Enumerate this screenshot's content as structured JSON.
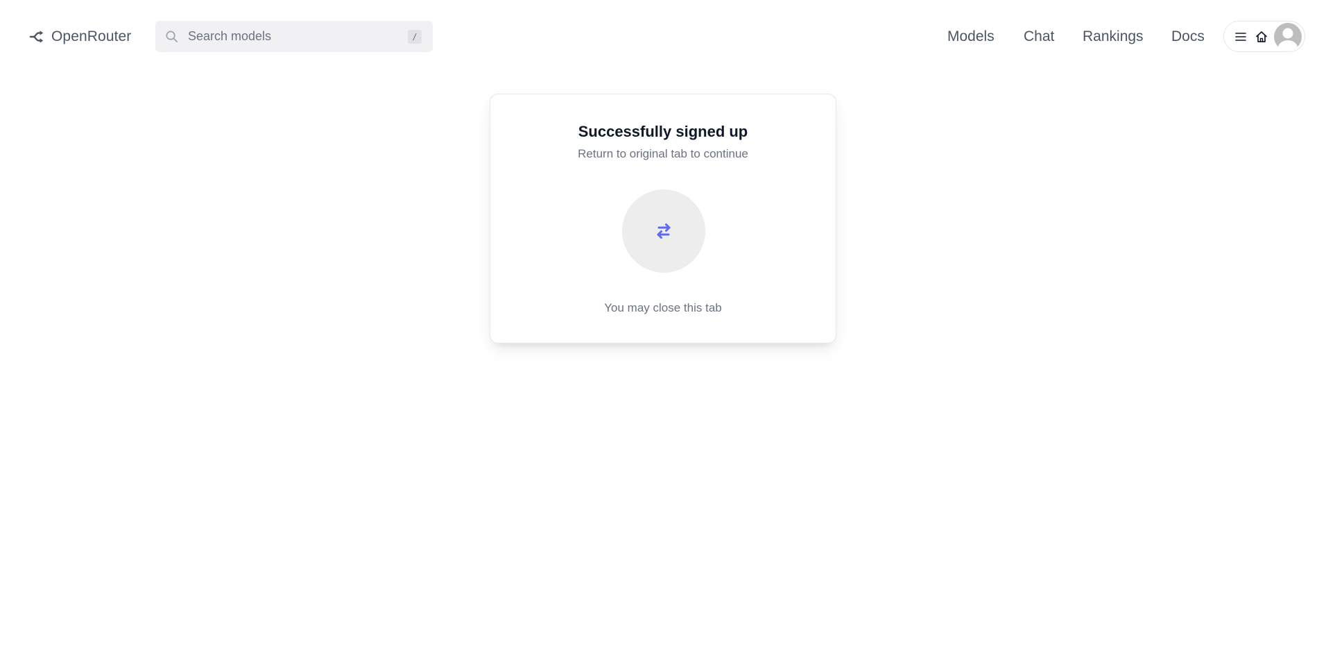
{
  "header": {
    "brand_name": "OpenRouter",
    "search": {
      "placeholder": "Search models",
      "shortcut_key": "/"
    },
    "nav": {
      "models": "Models",
      "chat": "Chat",
      "rankings": "Rankings",
      "docs": "Docs"
    },
    "icons": {
      "logo": "openrouter-logo-icon",
      "search": "search-icon",
      "menu": "menu-icon",
      "home": "home-icon",
      "avatar": "avatar"
    }
  },
  "card": {
    "title": "Successfully signed up",
    "subtitle": "Return to original tab to continue",
    "icon": "swap-arrows-icon",
    "close_note": "You may close this tab"
  },
  "colors": {
    "accent": "#6366f1",
    "text_muted": "#6b7280",
    "icon_circle_bg": "#ededed"
  }
}
